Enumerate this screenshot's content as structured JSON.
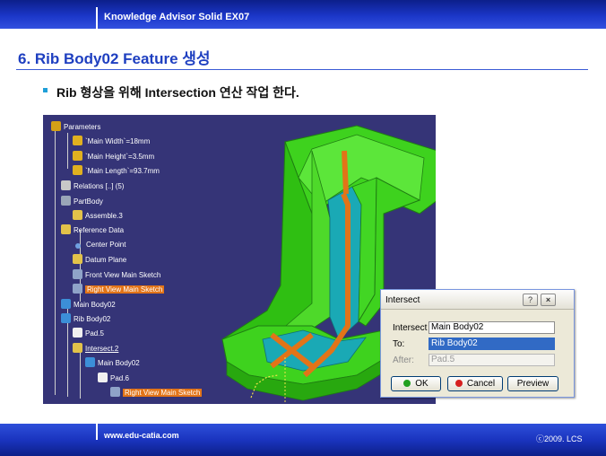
{
  "header": {
    "course_title": "Knowledge Advisor Solid EX07"
  },
  "slide": {
    "title": "6. Rib Body02 Feature 생성",
    "bullet": "Rib 형상을 위해 Intersection 연산 작업 한다."
  },
  "tree": {
    "items": [
      {
        "label": "Parameters",
        "icon": "parameters-icon",
        "color": "#d4a017"
      },
      {
        "label": "`Main Width`=18mm",
        "icon": "parameter-icon",
        "color": "#e0b020"
      },
      {
        "label": "`Main Height`=3.5mm",
        "icon": "parameter-icon",
        "color": "#e0b020"
      },
      {
        "label": "`Main Length`=93.7mm",
        "icon": "parameter-icon",
        "color": "#e0b020"
      },
      {
        "label": "Relations [..] (5)",
        "icon": "relations-icon",
        "color": "#c8c8c8"
      },
      {
        "label": "PartBody",
        "icon": "partbody-icon",
        "color": "#9aa6b8"
      },
      {
        "label": "Assemble.3",
        "icon": "assemble-icon",
        "color": "#e2c24a"
      },
      {
        "label": "Reference Data",
        "icon": "reference-data-icon",
        "color": "#e2c24a"
      },
      {
        "label": "Center Point",
        "icon": "point-icon",
        "color": "#6fa0e0"
      },
      {
        "label": "Datum Plane",
        "icon": "plane-icon",
        "color": "#e2c24a"
      },
      {
        "label": "Front View Main Sketch",
        "icon": "sketch-icon",
        "color": "#8fa3c8"
      },
      {
        "label": "Right View Main Sketch",
        "icon": "sketch-icon",
        "color": "#8fa3c8"
      },
      {
        "label": "Main Body02",
        "icon": "body-icon",
        "color": "#3c8fd8"
      },
      {
        "label": "Rib Body02",
        "icon": "body-icon",
        "color": "#3c8fd8"
      },
      {
        "label": "Pad.5",
        "icon": "pad-icon",
        "color": "#f0f0f0"
      },
      {
        "label": "Intersect.2",
        "icon": "intersect-icon",
        "color": "#e2c24a"
      },
      {
        "label": "Main Body02",
        "icon": "body-icon",
        "color": "#3c8fd8"
      },
      {
        "label": "Pad.6",
        "icon": "pad-icon",
        "color": "#f0f0f0"
      },
      {
        "label": "Right View Main Sketch",
        "icon": "sketch-icon",
        "color": "#8fa3c8"
      }
    ]
  },
  "dialog": {
    "title": "Intersect",
    "help_label": "?",
    "close_label": "×",
    "intersect_label": "Intersect",
    "intersect_value": "Main Body02",
    "to_label": "To:",
    "to_value": "Rib Body02",
    "after_label": "After:",
    "after_value": "Pad.5",
    "ok_label": "OK",
    "cancel_label": "Cancel",
    "preview_label": "Preview"
  },
  "footer": {
    "url": "www.edu-catia.com",
    "copyright": "ⓒ2009. LCS"
  },
  "colors": {
    "title_blue": "#1e3fc0",
    "viewport_bg": "#353477",
    "highlight_orange": "#e27418",
    "model_green": "#3ed21e",
    "model_teal": "#1aa9b5",
    "selection_blue": "#316ac5"
  }
}
